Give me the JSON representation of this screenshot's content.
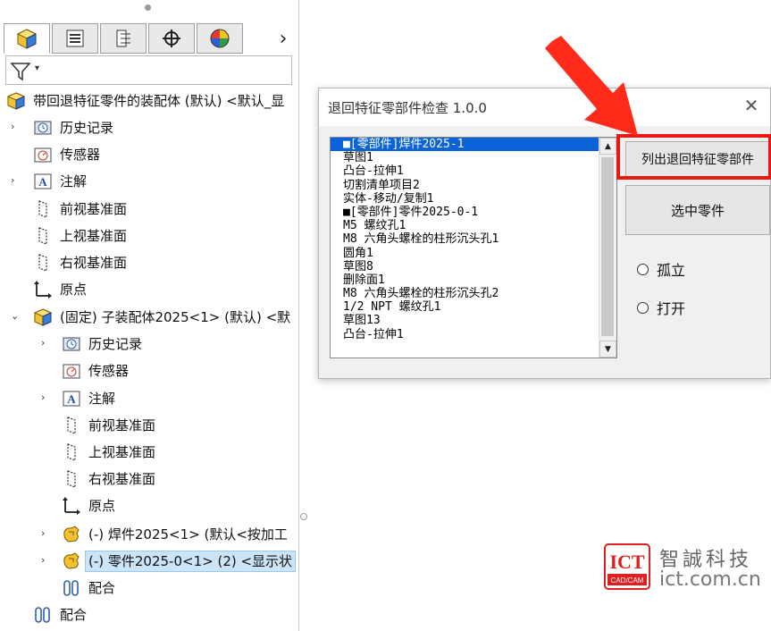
{
  "tree_panel": {
    "tabs": [
      {
        "icon": "feature-manager-icon",
        "active": true
      },
      {
        "icon": "property-manager-icon",
        "active": false
      },
      {
        "icon": "configuration-manager-icon",
        "active": false
      },
      {
        "icon": "dimxpert-icon",
        "active": false
      },
      {
        "icon": "display-manager-icon",
        "active": false
      }
    ],
    "tab_more": "›",
    "filter_dropdown": "▾",
    "rows": [
      {
        "arrow": "",
        "icon": "assembly-icon",
        "label": "带回退特征零件的装配体 (默认) <默认_显"
      },
      {
        "arrow": "›",
        "icon": "history-icon",
        "label": "历史记录"
      },
      {
        "arrow": "",
        "icon": "sensor-icon",
        "label": "传感器"
      },
      {
        "arrow": "›",
        "icon": "annotation-icon",
        "label": "注解"
      },
      {
        "arrow": "",
        "icon": "plane-icon",
        "label": "前视基准面"
      },
      {
        "arrow": "",
        "icon": "plane-icon",
        "label": "上视基准面"
      },
      {
        "arrow": "",
        "icon": "plane-icon",
        "label": "右视基准面"
      },
      {
        "arrow": "",
        "icon": "origin-icon",
        "label": "原点"
      },
      {
        "arrow": "⌄",
        "icon": "subassembly-icon",
        "label": "(固定) 子装配体2025<1> (默认) <默"
      },
      {
        "arrow": "›",
        "icon": "history-icon",
        "label": "历史记录"
      },
      {
        "arrow": "",
        "icon": "sensor-icon",
        "label": "传感器"
      },
      {
        "arrow": "›",
        "icon": "annotation-icon",
        "label": "注解"
      },
      {
        "arrow": "",
        "icon": "plane-icon",
        "label": "前视基准面"
      },
      {
        "arrow": "",
        "icon": "plane-icon",
        "label": "上视基准面"
      },
      {
        "arrow": "",
        "icon": "plane-icon",
        "label": "右视基准面"
      },
      {
        "arrow": "",
        "icon": "origin-icon",
        "label": "原点"
      },
      {
        "arrow": "›",
        "icon": "part-icon",
        "label": "(-) 焊件2025<1> (默认<按加工"
      },
      {
        "arrow": "›",
        "icon": "part-icon",
        "label": "(-) 零件2025-0<1> (2) <显示状"
      },
      {
        "arrow": "",
        "icon": "mate-icon",
        "label": "配合"
      },
      {
        "arrow": "",
        "icon": "mate-icon",
        "label": "配合"
      }
    ]
  },
  "dialog": {
    "title": "退回特征零部件检查 1.0.0",
    "close": "✕",
    "list_items": [
      "■[零部件]焊件2025-1",
      "草图1",
      "凸台-拉伸1",
      "切割清单项目2",
      "实体-移动/复制1",
      "■[零部件]零件2025-0-1",
      "M5 螺纹孔1",
      "M8 六角头螺栓的柱形沉头孔1",
      "圆角1",
      "草图8",
      "删除面1",
      "M8 六角头螺栓的柱形沉头孔2",
      "1/2 NPT 螺纹孔1",
      "草图13",
      "凸台-拉伸1"
    ],
    "scroll_up": "▲",
    "scroll_down": "▼",
    "btn_list": "列出退回特征零部件",
    "btn_select": "选中零件",
    "radio_isolate": "孤立",
    "radio_open": "打开"
  },
  "watermark": {
    "badge_top": "ICT",
    "badge_bottom": "CAD/CAM",
    "name": "智誠科技",
    "url": "ict.com.cn"
  },
  "colors": {
    "highlight_red": "#e8190f",
    "selection_blue": "#0a64d8",
    "tree_selection": "#cce4f7"
  }
}
